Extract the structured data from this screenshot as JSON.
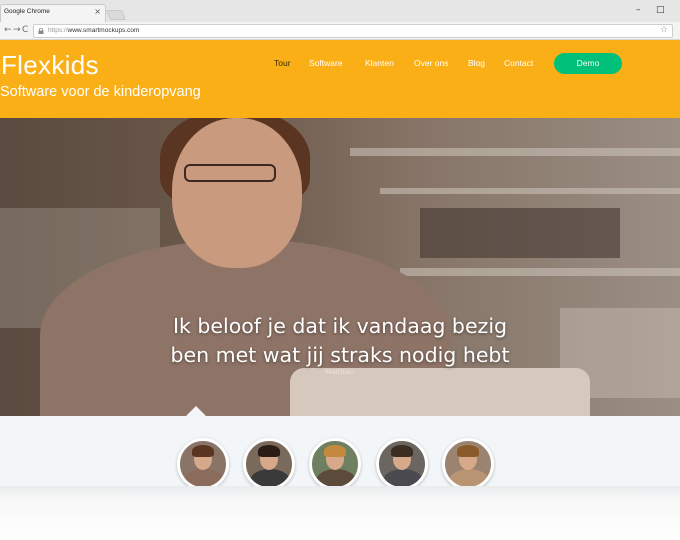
{
  "browser": {
    "tab_title": "Google Chrome",
    "tab_close": "×",
    "window_controls": [
      "–",
      "□"
    ],
    "nav_icons": [
      "←",
      "→",
      "C"
    ],
    "url_prefix": "https://",
    "url_domain": "www.smartmockups.com",
    "star": "☆"
  },
  "site": {
    "logo": "Flexkids",
    "tagline": "Software voor de kinderopvang",
    "brand_color": "#fbaf17",
    "demo_color": "#00c07a",
    "nav": [
      {
        "label": "Tour",
        "active": true
      },
      {
        "label": "Software"
      },
      {
        "label": "Klanten"
      },
      {
        "label": "Over ons"
      },
      {
        "label": "Blog"
      },
      {
        "label": "Contact"
      }
    ],
    "demo_label": "Demo"
  },
  "hero": {
    "quote_line1": "Ik beloof je dat ik vandaag bezig",
    "quote_line2": "ben met wat jij straks nodig hebt",
    "author": "Matthieu"
  },
  "testimonials": {
    "avatars": [
      {
        "name": "avatar-1",
        "shirt": "#8b6b5c",
        "hair": "#5a3521"
      },
      {
        "name": "avatar-2",
        "shirt": "#3a3a3a",
        "hair": "#2a1d16"
      },
      {
        "name": "avatar-3",
        "shirt": "#5c4a3a",
        "hair": "#c5893d"
      },
      {
        "name": "avatar-4",
        "shirt": "#4a4a50",
        "hair": "#3b2d22"
      },
      {
        "name": "avatar-5",
        "shirt": "#b89472",
        "hair": "#8a5a2a"
      }
    ]
  }
}
